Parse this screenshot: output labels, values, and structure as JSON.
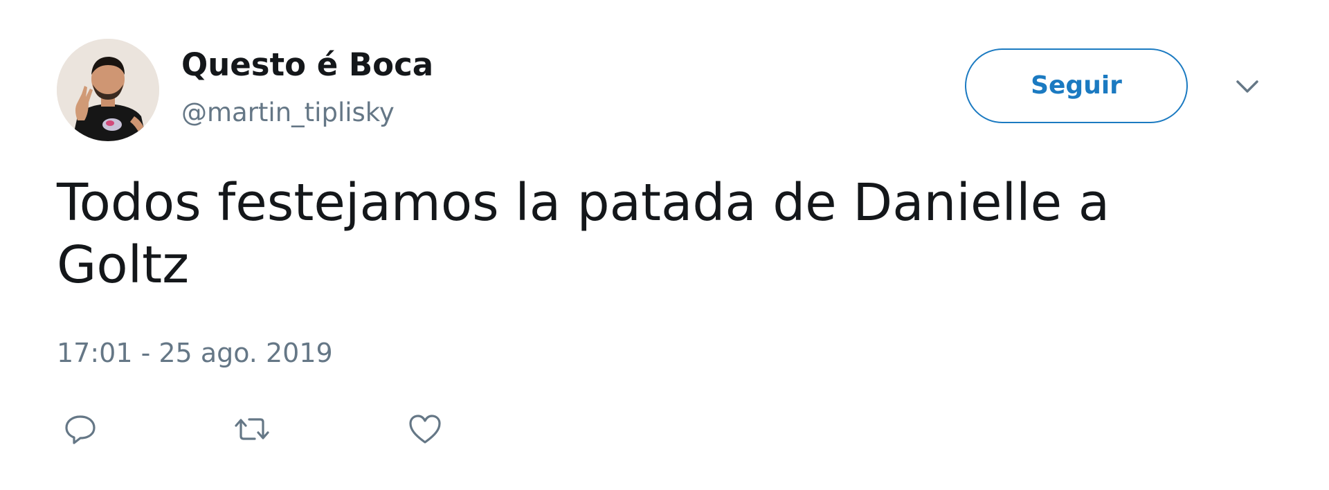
{
  "user": {
    "display_name": "Questo é Boca",
    "handle": "@martin_tiplisky",
    "avatar_icon": "user-avatar-photo"
  },
  "follow_button": {
    "label": "Seguir",
    "color": "#1b7ac1"
  },
  "menu": {
    "caret_icon": "chevron-down-icon"
  },
  "tweet": {
    "text": "Todos festejamos la patada de Danielle a Goltz",
    "timestamp": "17:01 - 25 ago. 2019"
  },
  "actions": [
    {
      "icon": "reply-icon"
    },
    {
      "icon": "retweet-icon"
    },
    {
      "icon": "like-icon"
    }
  ],
  "colors": {
    "text_primary": "#14171a",
    "text_secondary": "#657786",
    "accent": "#1b7ac1",
    "background": "#ffffff"
  }
}
